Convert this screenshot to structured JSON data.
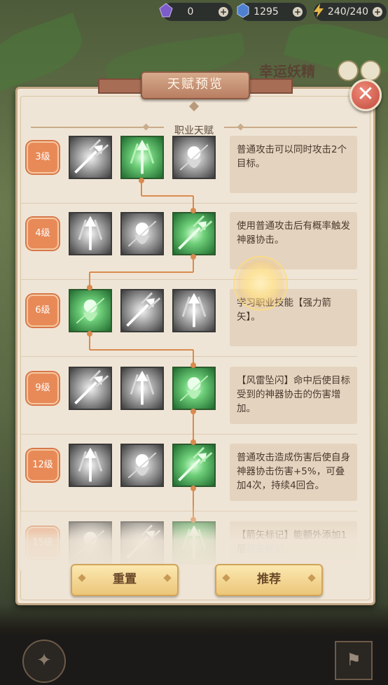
{
  "resources": [
    {
      "name": "purple-crystal-icon",
      "value": "0",
      "color": "#7b5cc9"
    },
    {
      "name": "blue-crystal-icon",
      "value": "1295",
      "color": "#4f7fd0"
    },
    {
      "name": "energy-icon",
      "value": "240/240",
      "color": "#e8b84a"
    }
  ],
  "background": {
    "character_name": "幸运妖精"
  },
  "panel": {
    "title": "天赋预览",
    "section_title": "职业天赋",
    "close_icon": "close-icon"
  },
  "rows": [
    {
      "level": "3级",
      "desc": "普通攻击可以同时攻击2个目标。",
      "selected": 1
    },
    {
      "level": "4级",
      "desc": "使用普通攻击后有概率触发神器协击。",
      "selected": 2
    },
    {
      "level": "6级",
      "desc": "学习职业技能【强力箭矢】。",
      "selected": 0
    },
    {
      "level": "9级",
      "desc": "【风雷坠闪】命中后使目标受到的神器协击的伤害增加。",
      "selected": 2
    },
    {
      "level": "12级",
      "desc": "普通攻击造成伤害后使自身神器协击伤害+5%，可叠加4次，持续4回合。",
      "selected": 2
    },
    {
      "level": "15级",
      "desc": "【箭矢标记】能额外添加1层",
      "desc_highlight": "箭矢标记",
      "selected": 2
    }
  ],
  "buttons": {
    "reset": "重置",
    "recommend": "推荐"
  },
  "colors": {
    "accent": "#e88a58",
    "selected_icon": "#3fa64e",
    "panel": "#efe5d6",
    "connector": "#d98b4e"
  }
}
